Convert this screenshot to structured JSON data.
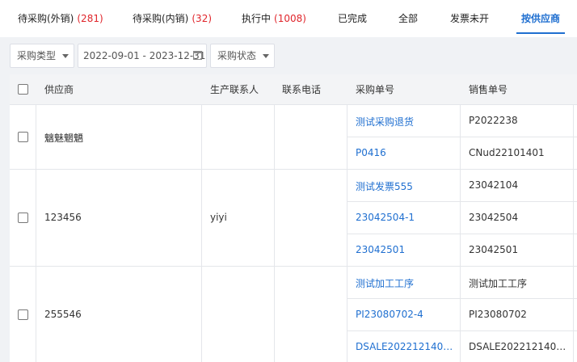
{
  "tabs": [
    {
      "label": "待采购(外销)",
      "count": "(281)"
    },
    {
      "label": "待采购(内销)",
      "count": "(32)"
    },
    {
      "label": "执行中",
      "count": "(1008)"
    },
    {
      "label": "已完成",
      "count": ""
    },
    {
      "label": "全部",
      "count": ""
    },
    {
      "label": "发票未开",
      "count": ""
    },
    {
      "label": "按供应商",
      "count": ""
    }
  ],
  "active_tab": "按供应商",
  "filters": {
    "purchase_type": "采购类型",
    "date_range": "2022-09-01 - 2023-12-31",
    "purchase_status": "采购状态"
  },
  "table": {
    "headers": {
      "supplier": "供应商",
      "contact": "生产联系人",
      "phone": "联系电话",
      "po_no": "采购单号",
      "so_no": "销售单号"
    },
    "groups": [
      {
        "supplier": "魑魅魍魉",
        "contact": "",
        "phone": "",
        "orders": [
          {
            "po": "测试采购退货",
            "so": "P2022238"
          },
          {
            "po": "P0416",
            "so": "CNud22101401"
          }
        ]
      },
      {
        "supplier": "123456",
        "contact": "yiyi",
        "phone": "",
        "orders": [
          {
            "po": "测试发票555",
            "so": "23042104"
          },
          {
            "po": "23042504-1",
            "so": "23042504"
          },
          {
            "po": "23042501",
            "so": "23042501"
          }
        ]
      },
      {
        "supplier": "255546",
        "contact": "",
        "phone": "",
        "orders": [
          {
            "po": "测试加工工序",
            "so": "测试加工工序"
          },
          {
            "po": "PI23080702-4",
            "so": "PI23080702"
          },
          {
            "po": "DSALE2022121400...",
            "so": "DSALE2022121400..."
          }
        ]
      }
    ]
  },
  "colors": {
    "accent": "#1f6fd0",
    "count_red": "#e0252b",
    "page_bg": "#f0f2f5",
    "header_bg": "#f3f4f6"
  }
}
